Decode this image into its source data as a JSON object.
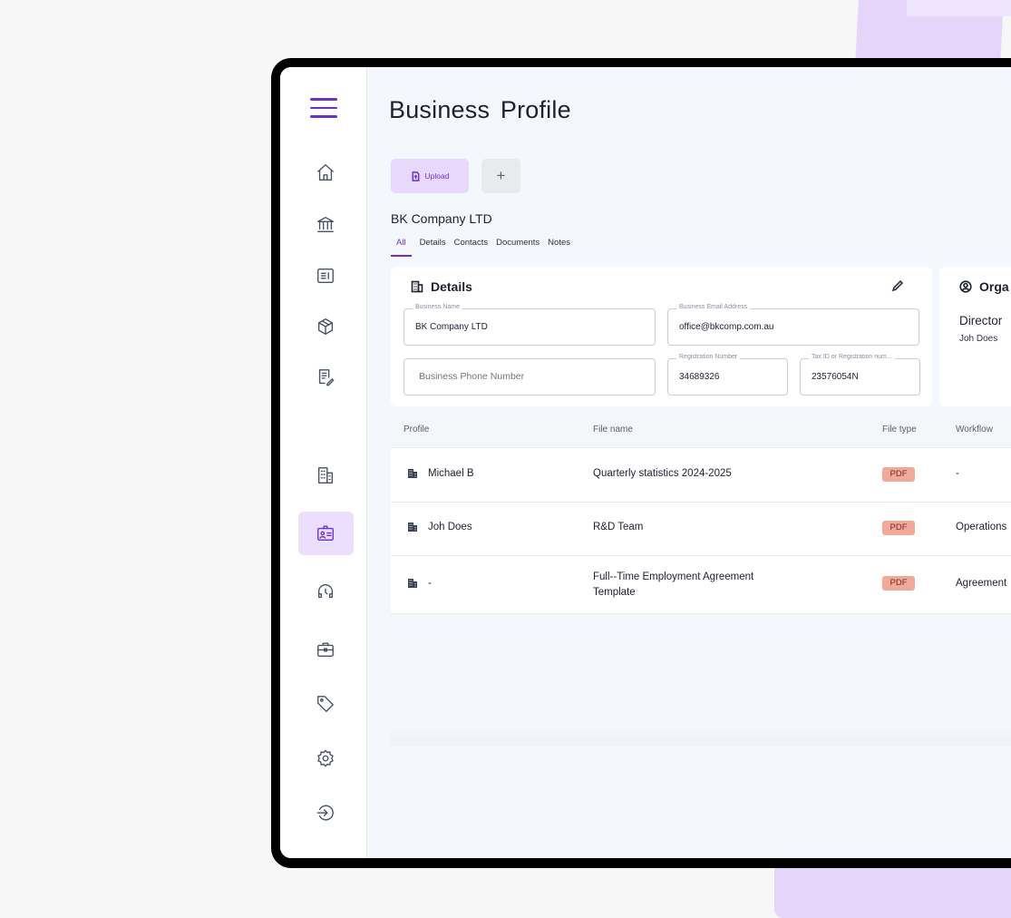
{
  "page": {
    "title": "Business  Profile"
  },
  "toolbar": {
    "upload_label": "Upload",
    "add_label": "+"
  },
  "company": {
    "name": "BK Company LTD"
  },
  "tabs": [
    {
      "label": "All",
      "active": true
    },
    {
      "label": "Details",
      "active": false
    },
    {
      "label": "Contacts",
      "active": false
    },
    {
      "label": "Documents",
      "active": false
    },
    {
      "label": "Notes",
      "active": false
    }
  ],
  "details": {
    "title": "Details",
    "business_name": {
      "label": "Business Name",
      "value": "BK Company LTD"
    },
    "business_email": {
      "label": "Business Email Address",
      "value": "office@bkcomp.com.au"
    },
    "business_phone": {
      "placeholder": "Business Phone Number"
    },
    "registration_number": {
      "label": "Registration Number",
      "value": "34689326"
    },
    "tax_id": {
      "label": "Tax ID or Registration num...",
      "value": "23576054N"
    }
  },
  "organisation": {
    "title": "Orga",
    "role": "Director",
    "name": "Joh Does"
  },
  "table": {
    "headers": {
      "profile": "Profile",
      "file_name": "File name",
      "file_type": "File type",
      "workflow": "Workflow"
    },
    "rows": [
      {
        "profile": "Michael B",
        "file_name": "Quarterly statistics 2024-2025",
        "file_type": "PDF",
        "workflow": "-"
      },
      {
        "profile": "Joh Does",
        "file_name": "R&D Team",
        "file_type": "PDF",
        "workflow": "Operations"
      },
      {
        "profile": "-",
        "file_name": "Full--Time Employment Agreement Template",
        "file_type": "PDF",
        "workflow": "Agreement"
      }
    ]
  },
  "sidebar": {
    "icons": [
      "menu-icon",
      "home-icon",
      "bank-icon",
      "news-icon",
      "package-icon",
      "contract-icon",
      "building-icon",
      "id-card-icon",
      "headset-icon",
      "briefcase-icon",
      "tag-icon",
      "gear-icon",
      "logout-icon"
    ],
    "active": "id-card-icon"
  },
  "colors": {
    "accent": "#6b2fd6",
    "accent_light": "#e8d9fc",
    "pdf_badge": "#f3a99a"
  }
}
